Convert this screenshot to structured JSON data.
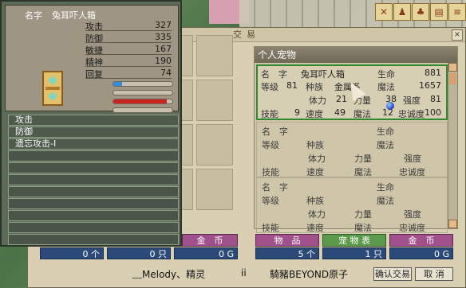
{
  "toolbar": {
    "icons": [
      "x-pose-icon",
      "figure-icon",
      "group-icon",
      "card-icon",
      "scroll-icon",
      "shield-icon"
    ]
  },
  "trade": {
    "title": "交易",
    "close_label": "×",
    "confirm_label": "确认交易",
    "cancel_label": "取 消"
  },
  "info": {
    "name_label": "名字",
    "name_value": "兔耳吓人箱",
    "stats": [
      {
        "key": "攻击",
        "value": "327"
      },
      {
        "key": "防御",
        "value": "335"
      },
      {
        "key": "敏捷",
        "value": "167"
      },
      {
        "key": "精神",
        "value": "190"
      },
      {
        "key": "回复",
        "value": "74"
      }
    ],
    "bars": [
      {
        "fraction": 0.15,
        "color": "#2f8de4"
      },
      {
        "fraction": 0.0,
        "color": "#999"
      },
      {
        "fraction": 0.9,
        "color": "#cc2222"
      },
      {
        "fraction": 0.0,
        "color": "#999"
      }
    ],
    "skills": [
      "攻击",
      "防御",
      "遗忘攻击-I",
      "",
      "",
      "",
      "",
      "",
      "",
      "",
      ""
    ]
  },
  "pets": {
    "title": "个人宠物",
    "cards": [
      {
        "name_label": "名　字",
        "name": "兔耳吓人箱",
        "hp_label": "生命",
        "hp": "881",
        "level_label": "等级",
        "level": "81",
        "race_label": "种族",
        "race": "金属系",
        "mp_label": "魔法",
        "mp": "1657",
        "vit_label": "体力",
        "vit": "21",
        "str_label": "力量",
        "str": "38",
        "tough_label": "强度",
        "tough": "81",
        "skill_label": "技能",
        "skill": "9",
        "spd_label": "速度",
        "spd": "49",
        "mag_label": "魔法",
        "mag": "12",
        "loy_label": "忠诚度",
        "loy": "100"
      },
      {
        "name_label": "名　字",
        "name": "",
        "hp_label": "生命",
        "hp": "",
        "level_label": "等级",
        "level": "",
        "race_label": "种族",
        "race": "",
        "mp_label": "魔法",
        "mp": "",
        "vit_label": "体力",
        "vit": "",
        "str_label": "力量",
        "str": "",
        "tough_label": "强度",
        "tough": "",
        "skill_label": "技能",
        "skill": "",
        "spd_label": "速度",
        "spd": "",
        "mag_label": "魔法",
        "mag": "",
        "loy_label": "忠诚度",
        "loy": ""
      },
      {
        "name_label": "名　字",
        "name": "",
        "hp_label": "生命",
        "hp": "",
        "level_label": "等级",
        "level": "",
        "race_label": "种族",
        "race": "",
        "mp_label": "魔法",
        "mp": "",
        "vit_label": "体力",
        "vit": "",
        "str_label": "力量",
        "str": "",
        "tough_label": "强度",
        "tough": "",
        "skill_label": "技能",
        "skill": "",
        "spd_label": "速度",
        "spd": "",
        "mag_label": "魔法",
        "mag": "",
        "loy_label": "忠诚度",
        "loy": ""
      }
    ]
  },
  "left_bar": {
    "gold_label": "金　币",
    "items_value": "0 个",
    "pets_value": "0 只",
    "gold_value": "0 G",
    "player_name": "﹏Melody、精灵"
  },
  "right_bar": {
    "items_label": "物　品",
    "pets_label": "宠 物 表",
    "gold_label": "金　币",
    "items_value": "5 个",
    "pets_value": "1 只",
    "gold_value": "0 G",
    "player_name": "騎豬BEYOND原子"
  },
  "separator": "ii"
}
